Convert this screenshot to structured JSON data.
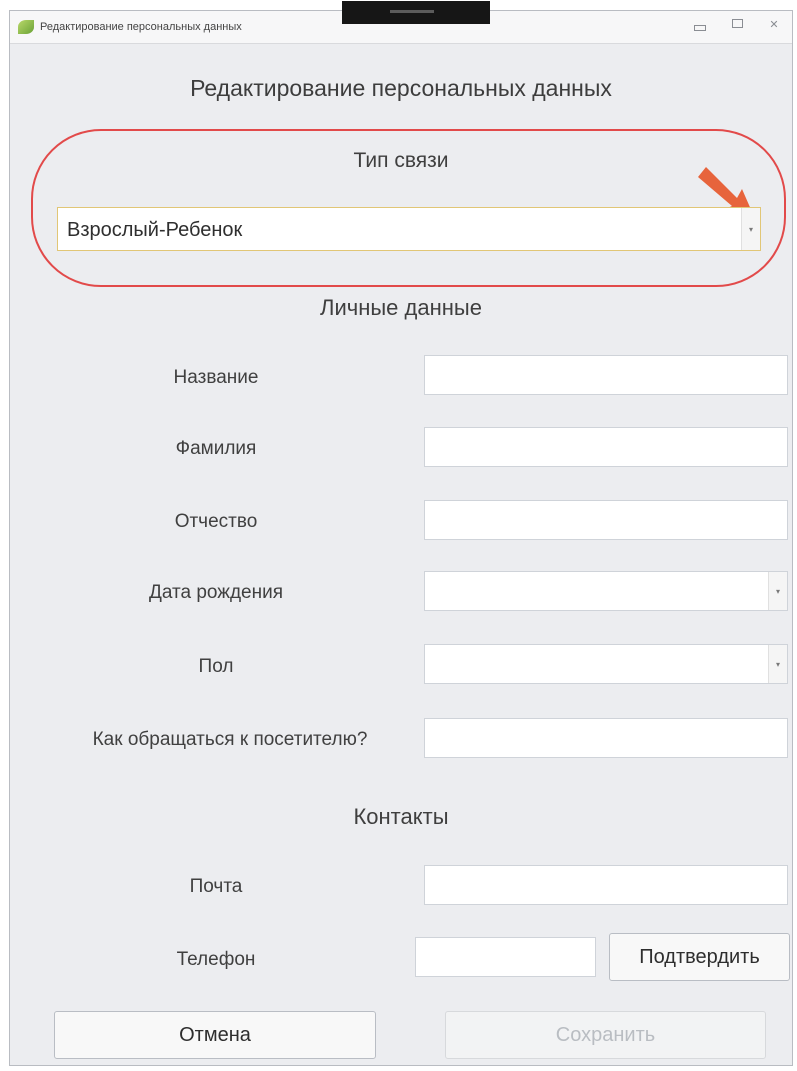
{
  "window": {
    "title": "Редактирование персональных данных"
  },
  "form": {
    "heading": "Редактирование персональных данных",
    "relationship_type": {
      "title": "Тип связи",
      "selected_value": "Взрослый-Ребенок",
      "dropdown_icon": "chevron-down-icon"
    },
    "personal_data": {
      "title": "Личные данные",
      "fields": {
        "name": "Название",
        "surname": "Фамилия",
        "patronymic": "Отчество",
        "birthdate": "Дата рождения",
        "gender": "Пол",
        "address_as": "Как обращаться к посетителю?"
      }
    },
    "contacts": {
      "title": "Контакты",
      "email_label": "Почта",
      "phone_label": "Телефон",
      "confirm_label": "Подтвердить"
    },
    "actions": {
      "cancel": "Отмена",
      "save": "Сохранить"
    }
  },
  "colors": {
    "window_bg": "#ecedf0",
    "highlight_red": "#e24a4a",
    "arrow_orange": "#e7643c",
    "selected_border": "#e1c676"
  }
}
